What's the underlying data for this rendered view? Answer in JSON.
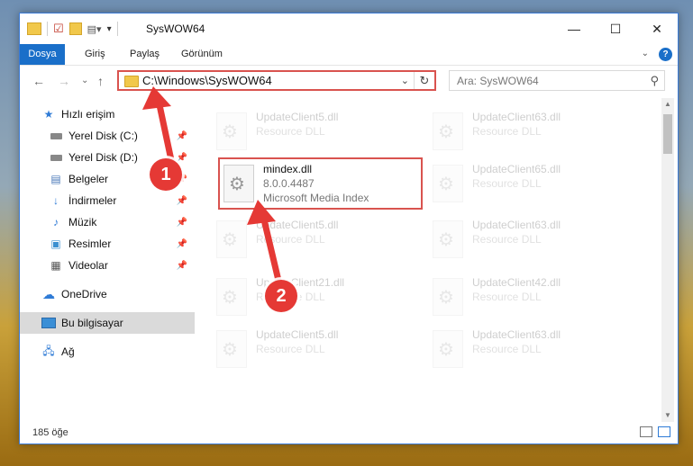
{
  "window": {
    "title": "SysWOW64",
    "controls": {
      "minimize": "—",
      "maximize": "☐",
      "close": "✕"
    }
  },
  "ribbon": {
    "tabs": [
      "Dosya",
      "Giriş",
      "Paylaş",
      "Görünüm"
    ],
    "help": "?"
  },
  "address": {
    "path": "C:\\Windows\\SysWOW64",
    "search_placeholder": "Ara: SysWOW64"
  },
  "sidebar": {
    "items": [
      {
        "label": "Hızlı erişim",
        "icon": "star-icon"
      },
      {
        "label": "Yerel Disk (C:)",
        "icon": "drive-icon"
      },
      {
        "label": "Yerel Disk (D:)",
        "icon": "drive-icon"
      },
      {
        "label": "Belgeler",
        "icon": "documents-icon"
      },
      {
        "label": "İndirmeler",
        "icon": "download-icon"
      },
      {
        "label": "Müzik",
        "icon": "music-icon"
      },
      {
        "label": "Resimler",
        "icon": "pictures-icon"
      },
      {
        "label": "Videolar",
        "icon": "videos-icon"
      },
      {
        "label": "OneDrive",
        "icon": "cloud-icon"
      },
      {
        "label": "Bu bilgisayar",
        "icon": "computer-icon"
      },
      {
        "label": "Ağ",
        "icon": "network-icon"
      }
    ]
  },
  "files": [
    {
      "name": "UpdateClient5.dll",
      "desc": "Resource DLL"
    },
    {
      "name": "UpdateClient63.dll",
      "desc": "Resource DLL"
    },
    {
      "name": "mindex.dll",
      "desc": "8.0.0.4487",
      "desc2": "Microsoft Media Index"
    },
    {
      "name": "UpdateClient65.dll",
      "desc": "Resource DLL"
    },
    {
      "name": "UpdateClient5.dll",
      "desc": "Resource DLL"
    },
    {
      "name": "UpdateClient63.dll",
      "desc": "Resource DLL"
    },
    {
      "name": "UpdateClient21.dll",
      "desc": "Resource DLL"
    },
    {
      "name": "UpdateClient42.dll",
      "desc": "Resource DLL"
    },
    {
      "name": "UpdateClient5.dll",
      "desc": "Resource DLL"
    },
    {
      "name": "UpdateClient63.dll",
      "desc": "Resource DLL"
    }
  ],
  "status": {
    "count": "185 öğe"
  },
  "callouts": {
    "one": "1",
    "two": "2"
  },
  "colors": {
    "accent": "#1a6fc9",
    "highlight": "#d9534f",
    "callout": "#e53935"
  }
}
